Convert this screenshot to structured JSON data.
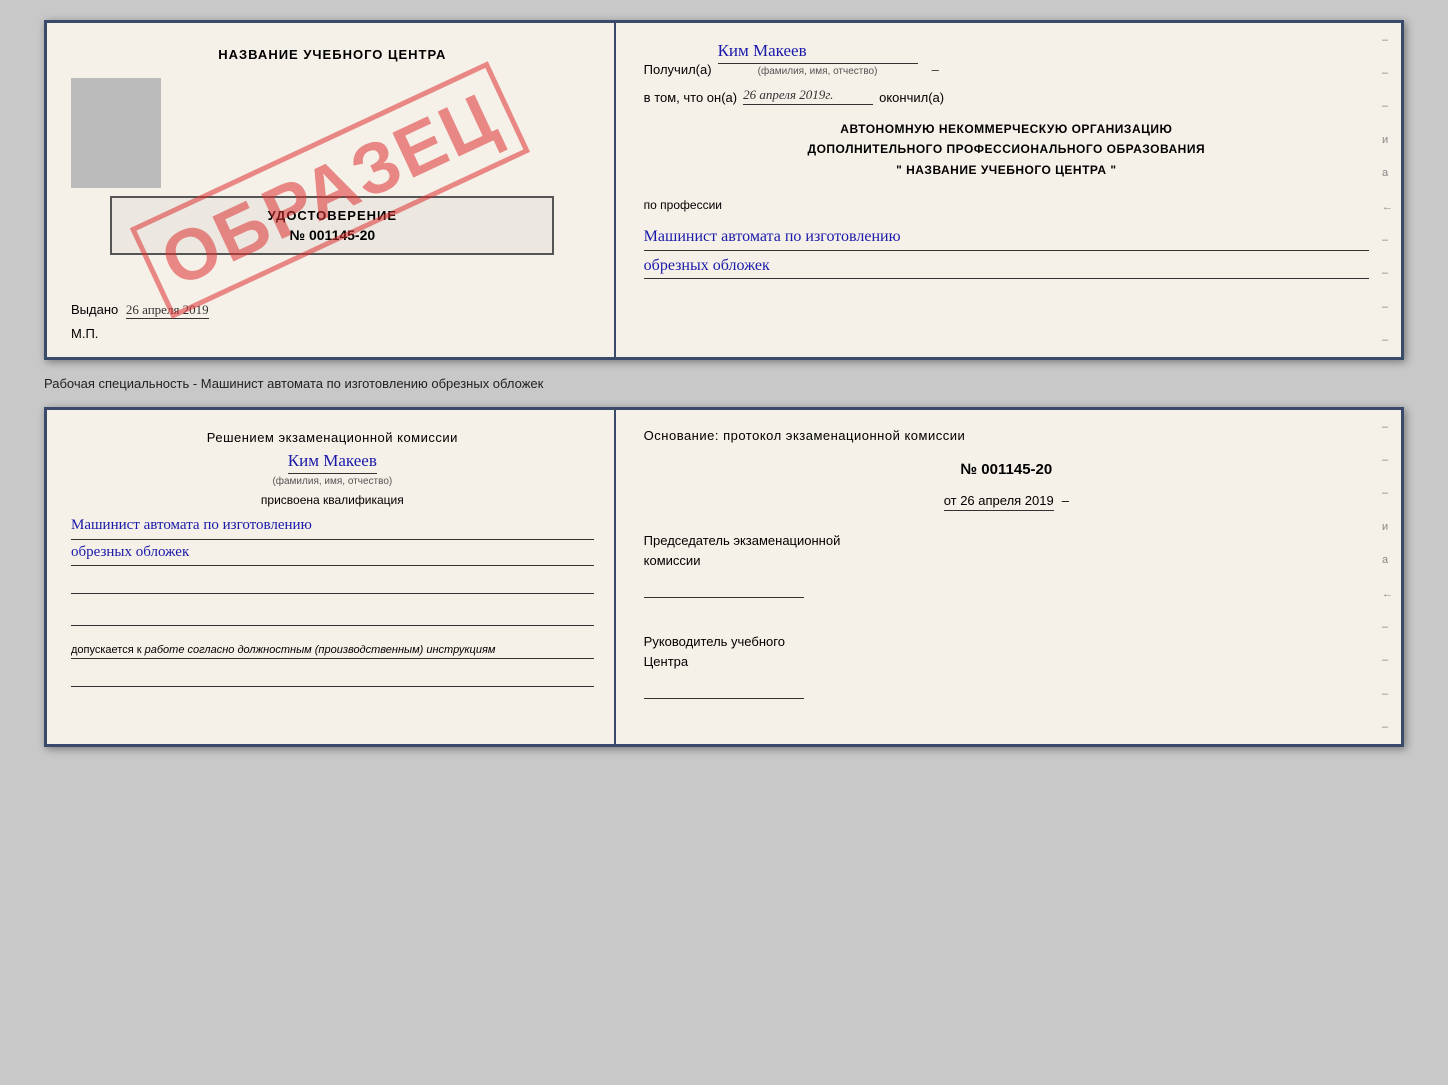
{
  "top_cert": {
    "left": {
      "title": "НАЗВАНИЕ УЧЕБНОГО ЦЕНТРА",
      "watermark": "ОБРАЗЕЦ",
      "udostoverenie_title": "УДОСТОВЕРЕНИЕ",
      "udostoverenie_number": "№ 001145-20",
      "vydano_label": "Выдано",
      "vydano_date": "26 апреля 2019",
      "mp_label": "М.П."
    },
    "right": {
      "poluchil_label": "Получил(а)",
      "poluchil_name": "Ким Макеев",
      "fio_sub": "(фамилия, имя, отчество)",
      "vtom_label": "в том, что он(а)",
      "date_value": "26 апреля 2019г.",
      "okonchil_label": "окончил(а)",
      "org_line1": "АВТОНОМНУЮ НЕКОММЕРЧЕСКУЮ ОРГАНИЗАЦИЮ",
      "org_line2": "ДОПОЛНИТЕЛЬНОГО ПРОФЕССИОНАЛЬНОГО ОБРАЗОВАНИЯ",
      "org_line3": "\"   НАЗВАНИЕ УЧЕБНОГО ЦЕНТРА   \"",
      "po_professii": "по профессии",
      "profession_line1": "Машинист автомата по изготовлению",
      "profession_line2": "обрезных обложек",
      "dashes": [
        "-",
        "-",
        "-",
        "и",
        "а",
        "←",
        "-",
        "-",
        "-",
        "-"
      ]
    }
  },
  "specialty_label": "Рабочая специальность - Машинист автомата по изготовлению обрезных обложек",
  "bottom_cert": {
    "left": {
      "resheniyem_text": "Решением экзаменационной комиссии",
      "name": "Ким Макеев",
      "fio_sub": "(фамилия, имя, отчество)",
      "prisvoena": "присвоена квалификация",
      "profession_line1": "Машинист автомата по изготовлению",
      "profession_line2": "обрезных обложек",
      "dopuskaetsya_prefix": "допускается к",
      "dopuskaetsya_italic": "работе согласно должностным (производственным) инструкциям"
    },
    "right": {
      "osnovaniye": "Основание: протокол экзаменационной комиссии",
      "protocol_number": "№  001145-20",
      "ot_date": "от 26 апреля 2019",
      "predsedatel_label": "Председатель экзаменационной\nкомиссии",
      "rukovoditel_label": "Руководитель учебного\nЦентра",
      "dashes": [
        "-",
        "-",
        "-",
        "и",
        "а",
        "←",
        "-",
        "-",
        "-",
        "-"
      ]
    }
  }
}
